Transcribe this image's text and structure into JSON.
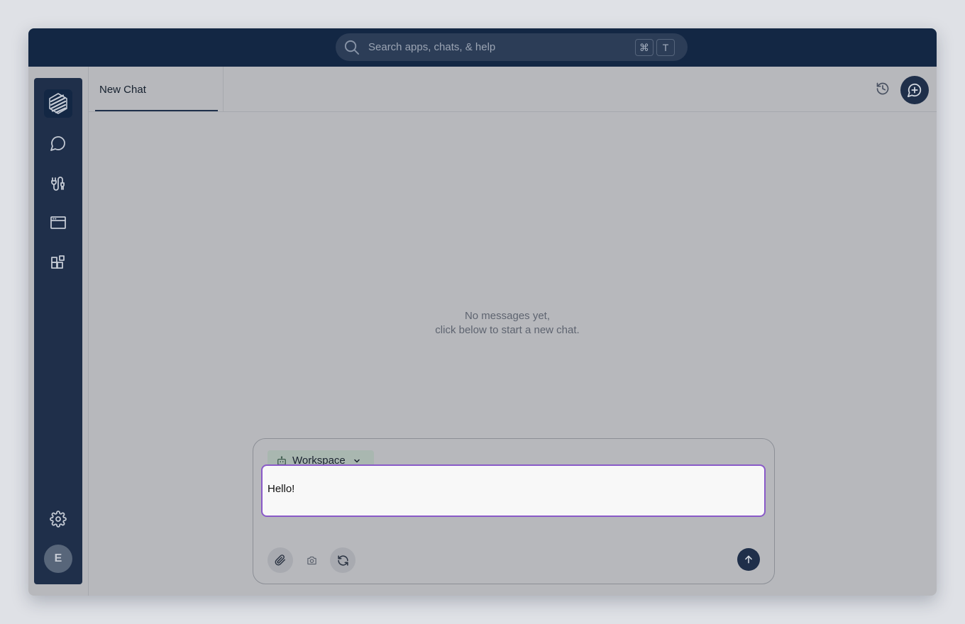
{
  "header": {
    "search": {
      "placeholder": "Search apps, chats, & help",
      "icon": "search-icon",
      "shortcut": [
        "⌘",
        "T"
      ]
    }
  },
  "sidebar": {
    "items": [
      {
        "name": "logo",
        "icon": "stripes-logo-icon",
        "active": true
      },
      {
        "name": "chats",
        "icon": "chat-bubble-icon"
      },
      {
        "name": "integrations",
        "icon": "plug-cable-icon"
      },
      {
        "name": "apps",
        "icon": "browser-window-icon"
      },
      {
        "name": "extensions",
        "icon": "blocks-icon"
      }
    ],
    "settings_icon": "gear-icon",
    "avatar_initial": "E"
  },
  "main": {
    "tabs": [
      {
        "label": "New Chat",
        "active": true
      }
    ],
    "history_icon": "history-icon",
    "new_chat_icon": "message-plus-icon",
    "empty_state": {
      "line1": "No messages yet,",
      "line2": "click below to start a new chat."
    },
    "composer": {
      "agent_label": "Workspace",
      "agent_icon": "bot-icon",
      "input_value": "Hello!",
      "tools": [
        "paperclip-icon",
        "camera-icon",
        "refresh-icon"
      ],
      "send_icon": "arrow-up-icon"
    }
  },
  "colors": {
    "topbar": "#132744",
    "sidebar": "#1f2f4a",
    "accent_focus": "#8a5ac8",
    "overlay_bg": "#b7b8bc"
  }
}
